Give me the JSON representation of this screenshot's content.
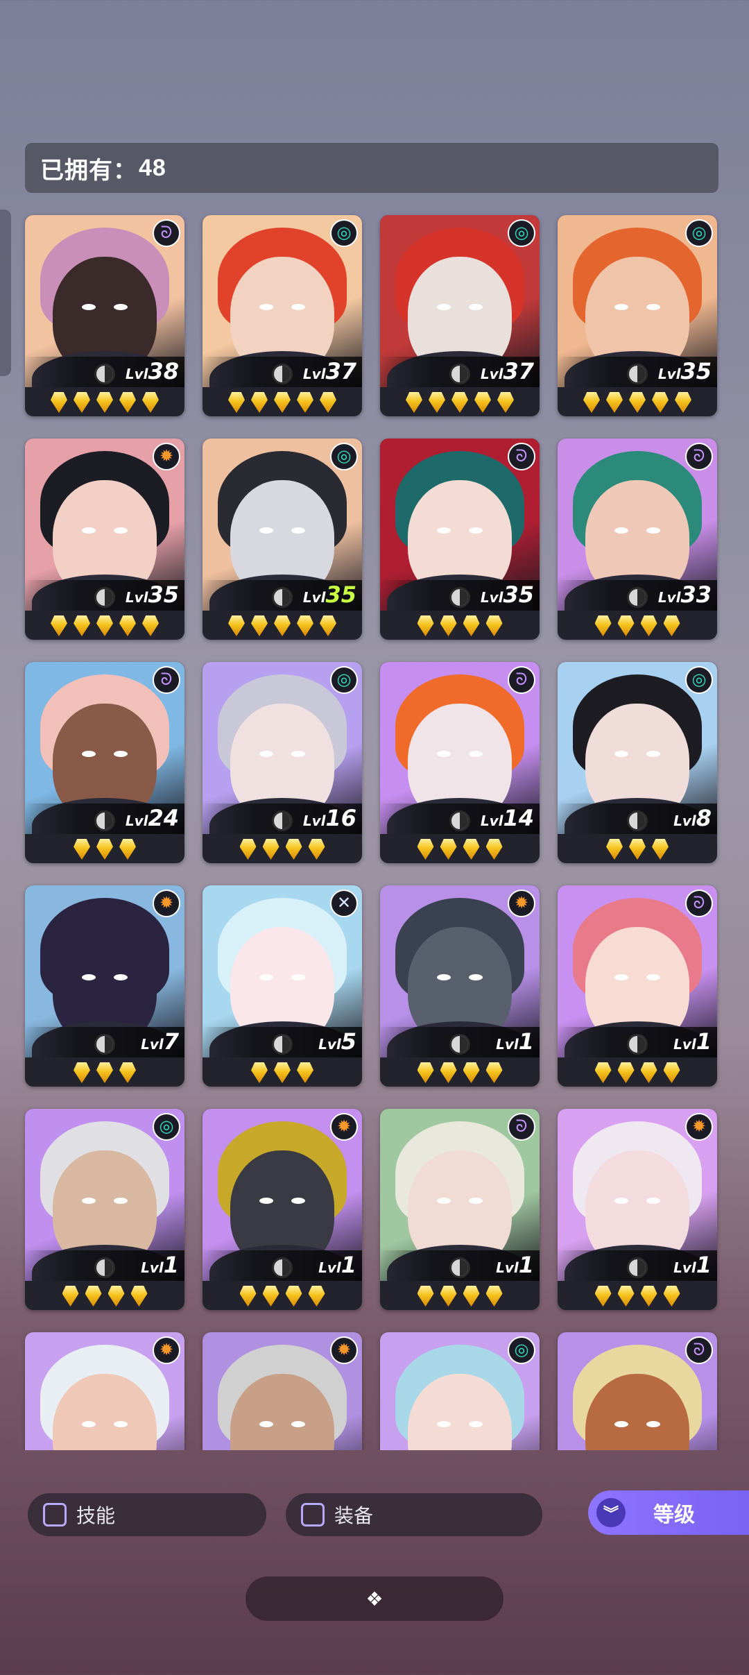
{
  "header": {
    "label": "已拥有：",
    "count": "48"
  },
  "heroes": [
    {
      "lvl": "38",
      "stars": 5,
      "elem": "purple",
      "elem_icon": "purple-spiral-icon",
      "bg": "#f3c2a0",
      "hair": "#c98fb8",
      "skin": "#3a2a2a"
    },
    {
      "lvl": "37",
      "stars": 5,
      "elem": "teal",
      "elem_icon": "teal-swirl-icon",
      "bg": "#f4c8a0",
      "hair": "#e0432a",
      "skin": "#f2d2c0"
    },
    {
      "lvl": "37",
      "stars": 5,
      "elem": "teal",
      "elem_icon": "teal-swirl-icon",
      "bg": "#c23a3a",
      "hair": "#d6342a",
      "skin": "#e9e0dc"
    },
    {
      "lvl": "35",
      "stars": 5,
      "elem": "teal",
      "elem_icon": "teal-swirl-icon",
      "bg": "#f0b890",
      "hair": "#e5652e",
      "skin": "#f0c4a8"
    },
    {
      "lvl": "35",
      "stars": 5,
      "elem": "orange",
      "elem_icon": "orange-gear-icon",
      "bg": "#e6a0a8",
      "hair": "#1c1c24",
      "skin": "#f3d0c6"
    },
    {
      "lvl": "35",
      "stars": 5,
      "elem": "teal",
      "elem_icon": "teal-swirl-icon",
      "bg": "#efc0a0",
      "hair": "#2a2a32",
      "skin": "#d8d8e0",
      "highlight": true
    },
    {
      "lvl": "35",
      "stars": 4,
      "elem": "purple",
      "elem_icon": "purple-spiral-icon",
      "bg": "#b01e32",
      "hair": "#1e6a6a",
      "skin": "#f4dcd4"
    },
    {
      "lvl": "33",
      "stars": 4,
      "elem": "purple",
      "elem_icon": "purple-spiral-icon",
      "bg": "#c88ee8",
      "hair": "#2b8a7a",
      "skin": "#f0c8b8"
    },
    {
      "lvl": "24",
      "stars": 3,
      "elem": "purple",
      "elem_icon": "purple-spiral-icon",
      "bg": "#7fb8e4",
      "hair": "#f2c0b8",
      "skin": "#8a5a48"
    },
    {
      "lvl": "16",
      "stars": 4,
      "elem": "teal",
      "elem_icon": "teal-swirl-icon",
      "bg": "#b8a0f0",
      "hair": "#c8c8d8",
      "skin": "#f0e0e0"
    },
    {
      "lvl": "14",
      "stars": 4,
      "elem": "purple",
      "elem_icon": "purple-spiral-icon",
      "bg": "#c68ef0",
      "hair": "#f06a2a",
      "skin": "#f0e4e8"
    },
    {
      "lvl": "8",
      "stars": 3,
      "elem": "teal",
      "elem_icon": "teal-swirl-icon",
      "bg": "#a8d0f0",
      "hair": "#1c1c22",
      "skin": "#f0dcd8"
    },
    {
      "lvl": "7",
      "stars": 3,
      "elem": "orange",
      "elem_icon": "orange-gear-icon",
      "bg": "#88b8e0",
      "hair": "#2a2440",
      "skin": "#2a2440"
    },
    {
      "lvl": "5",
      "stars": 3,
      "elem": "silver",
      "elem_icon": "silver-cross-icon",
      "bg": "#a8d8f0",
      "hair": "#d8f0f8",
      "skin": "#fbe6ea"
    },
    {
      "lvl": "1",
      "stars": 4,
      "elem": "orange",
      "elem_icon": "orange-gear-icon",
      "bg": "#b890e8",
      "hair": "#3a4150",
      "skin": "#58606e"
    },
    {
      "lvl": "1",
      "stars": 4,
      "elem": "purple",
      "elem_icon": "purple-spiral-icon",
      "bg": "#c890f0",
      "hair": "#e87a8a",
      "skin": "#f8dcd4"
    },
    {
      "lvl": "1",
      "stars": 4,
      "elem": "teal",
      "elem_icon": "teal-swirl-icon",
      "bg": "#c090f0",
      "hair": "#e0e0e4",
      "skin": "#d8b8a0"
    },
    {
      "lvl": "1",
      "stars": 4,
      "elem": "orange",
      "elem_icon": "orange-gear-icon",
      "bg": "#c490f0",
      "hair": "#c8a828",
      "skin": "#3a3a44"
    },
    {
      "lvl": "1",
      "stars": 4,
      "elem": "purple",
      "elem_icon": "purple-spiral-icon",
      "bg": "#a0c8a0",
      "hair": "#e8e8dc",
      "skin": "#f0dcd4"
    },
    {
      "lvl": "1",
      "stars": 4,
      "elem": "orange",
      "elem_icon": "orange-gear-icon",
      "bg": "#d8a0f0",
      "hair": "#f0e8f0",
      "skin": "#f4dcde"
    },
    {
      "lvl": "",
      "stars": 0,
      "elem": "orange",
      "elem_icon": "orange-gear-icon",
      "bg": "#c8a0f0",
      "hair": "#e8eef4",
      "skin": "#f0c8b8"
    },
    {
      "lvl": "",
      "stars": 0,
      "elem": "orange",
      "elem_icon": "orange-gear-icon",
      "bg": "#b090e0",
      "hair": "#d0d0d0",
      "skin": "#c8a088"
    },
    {
      "lvl": "",
      "stars": 0,
      "elem": "teal",
      "elem_icon": "teal-swirl-icon",
      "bg": "#c8a0f0",
      "hair": "#a8d8e8",
      "skin": "#f4dcd4"
    },
    {
      "lvl": "",
      "stars": 0,
      "elem": "purple",
      "elem_icon": "purple-spiral-icon",
      "bg": "#b890e8",
      "hair": "#e8d8a0",
      "skin": "#b86a40"
    }
  ],
  "level_prefix": "Lvl",
  "filters": {
    "skill_label": "技能",
    "equip_label": "装备"
  },
  "sort_button": {
    "label": "等级"
  },
  "expand_button": {
    "glyph": "❖"
  },
  "element_glyphs": {
    "purple": "ᘐ",
    "teal": "◎",
    "orange": "✹",
    "silver": "✕"
  }
}
